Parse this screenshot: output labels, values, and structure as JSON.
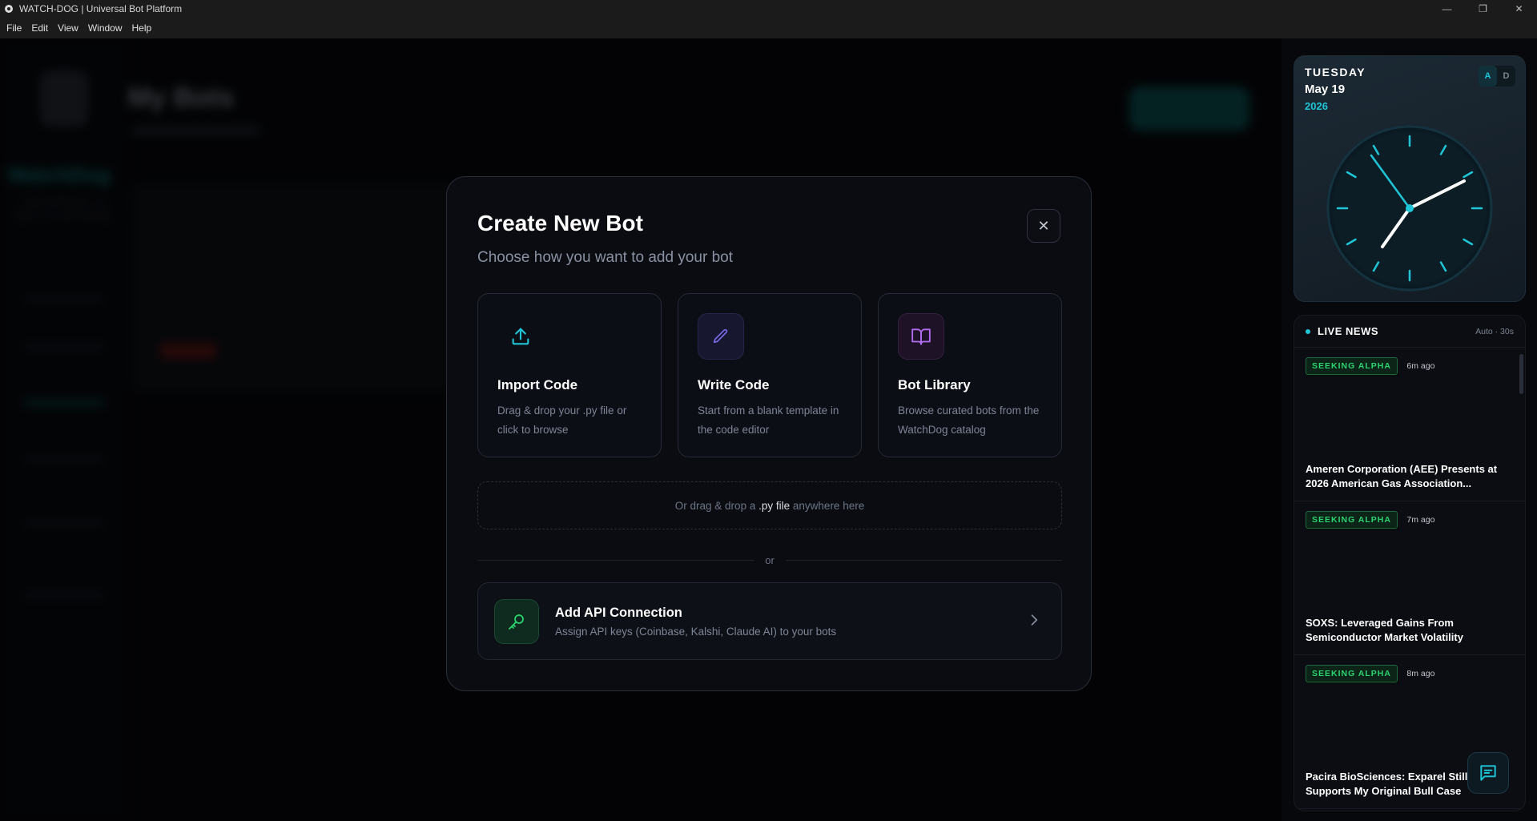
{
  "window": {
    "title": "WATCH-DOG | Universal Bot Platform",
    "controls": [
      "minimize",
      "restore",
      "close"
    ]
  },
  "menu": [
    "File",
    "Edit",
    "View",
    "Window",
    "Help"
  ],
  "background": {
    "brand": "WatchDog",
    "brand_sub": "UNIVERSAL AI BOT PLATFORM",
    "page_title": "My Bots"
  },
  "modal": {
    "title": "Create New Bot",
    "subtitle": "Choose how you want to add your bot",
    "close_icon": "close-icon",
    "cards": [
      {
        "title": "Import Code",
        "desc": "Drag & drop your .py file or click to browse",
        "icon": "upload-icon",
        "color": "#1fc6d8"
      },
      {
        "title": "Write Code",
        "desc": "Start from a blank template in the code editor",
        "icon": "pencil-icon",
        "color": "#7b6cf0"
      },
      {
        "title": "Bot Library",
        "desc": "Browse curated bots from the WatchDog catalog",
        "icon": "book-icon",
        "color": "#b36cf0"
      }
    ],
    "dropzone": {
      "prefix": "Or drag & drop a",
      "file": ".py file",
      "suffix": "anywhere here"
    },
    "divider": "or",
    "api": {
      "title": "Add API Connection",
      "subtitle": "Assign API keys (Coinbase, Kalshi, Claude AI) to your bots",
      "icon": "key-icon"
    }
  },
  "clock": {
    "day": "TUESDAY",
    "date": "May 19",
    "year": "2026",
    "toggle": [
      "A",
      "D"
    ],
    "accent": "#1fc6d8"
  },
  "news": {
    "title": "LIVE NEWS",
    "refresh": "Auto · 30s",
    "items": [
      {
        "source": "SEEKING ALPHA",
        "ago": "6m ago",
        "headline": "Ameren Corporation (AEE) Presents at 2026 American Gas Association..."
      },
      {
        "source": "SEEKING ALPHA",
        "ago": "7m ago",
        "headline": "SOXS: Leveraged Gains From Semiconductor Market Volatility"
      },
      {
        "source": "SEEKING ALPHA",
        "ago": "8m ago",
        "headline": "Pacira BioSciences: Exparel Still Supports My Original Bull Case"
      }
    ]
  }
}
